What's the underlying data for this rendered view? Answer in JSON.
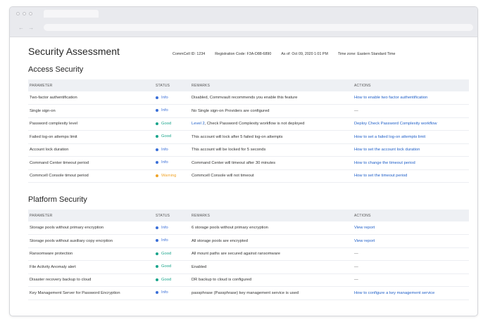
{
  "colors": {
    "info": "#3a6fd8",
    "good": "#1aa58c",
    "warning": "#f0a428",
    "link": "#1f5fc8"
  },
  "browser": {
    "nav_glyphs": "← →"
  },
  "header": {
    "title": "Security Assessment",
    "commcell_id": "CommCell ID: 1234",
    "registration_code": "Registration Code: F3A-D88-6890",
    "as_of": "As of: Oct 09, 2020 1:01 PM",
    "timezone": "Time zone: Eastern Standard Time"
  },
  "columns": {
    "parameter": "PARAMETER",
    "status": "STATUS",
    "remarks": "REMARKS",
    "actions": "ACTIONS"
  },
  "access": {
    "title": "Access Security",
    "rows": [
      {
        "parameter": "Two-factor authentification",
        "status": "Info",
        "level": "info",
        "remarks": "Disabled, Commvault recommends you enable this feature",
        "action": "How to enable two factor authentification"
      },
      {
        "parameter": "Single sign-on",
        "status": "Info",
        "level": "info",
        "remarks": "No Single sign-on Providers are configured",
        "action": "—"
      },
      {
        "parameter": "Password complexity level",
        "status": "Good",
        "level": "good",
        "remarks_link": "Level 2",
        "remarks": ", Check Password Complexity workflow is not deployed",
        "action": "Deploy Check Password Complexity workflow"
      },
      {
        "parameter": "Failed log-on attemps limit",
        "status": "Good",
        "level": "good",
        "remarks": "This account will lock after 5 failed log-on attempts",
        "action": "How to set a failed log-on attempts limit"
      },
      {
        "parameter": "Account lock duration",
        "status": "Info",
        "level": "info",
        "remarks": "This account will be locked for 5 seconds",
        "action": "How to set the account lock duration"
      },
      {
        "parameter": "Command Center timeout period",
        "status": "Info",
        "level": "info",
        "remarks": "Command Center will timeout after 30 minutes",
        "action": "How to change the timeout period"
      },
      {
        "parameter": "Commcell Console timout period",
        "status": "Warning",
        "level": "warning",
        "remarks": "Commcell Console will not timeout",
        "action": "How to set the timeout period"
      }
    ]
  },
  "platform": {
    "title": "Platform Security",
    "rows": [
      {
        "parameter": "Storage pools without primary encryption",
        "status": "Info",
        "level": "info",
        "remarks": "6 storage pools without primary encryption",
        "action": "View report"
      },
      {
        "parameter": "Storage pools without auxiliary copy encrption",
        "status": "Info",
        "level": "info",
        "remarks": "All storage pools are encrypted",
        "action": "View report"
      },
      {
        "parameter": "Ransomware protection",
        "status": "Good",
        "level": "good",
        "remarks": "All mount paths are secured against ransomware",
        "action": "—"
      },
      {
        "parameter": "File Activity Anomaly alert",
        "status": "Good",
        "level": "good",
        "remarks": "Enabled",
        "action": "—"
      },
      {
        "parameter": "Disaster recovery backup to cloud",
        "status": "Good",
        "level": "good",
        "remarks": "DR backup to cloud is configured",
        "action": "—"
      },
      {
        "parameter": "Key Management Server for Password Encryption",
        "status": "Info",
        "level": "info",
        "remarks": "passphrase (Passphrase) key management service is used",
        "action": "How to configure a key management service"
      }
    ]
  }
}
